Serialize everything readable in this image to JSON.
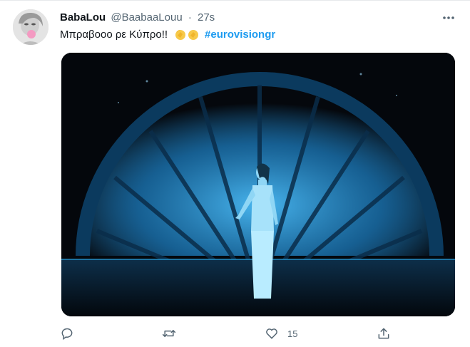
{
  "tweet": {
    "display_name": "BabaLou",
    "handle": "@BaabaaLouu",
    "separator": "·",
    "time": "27s",
    "text": "Μπραβοοο ρε Κύπρο!!",
    "emoji_icon": "clapping-hands-icon",
    "hashtag": "#eurovisiongr",
    "avatar_icon": "avatar",
    "media_description_icon": "stage-performance-image",
    "actions": {
      "reply_icon": "reply-icon",
      "retweet_icon": "retweet-icon",
      "like_icon": "heart-icon",
      "like_count": "15",
      "share_icon": "share-icon"
    },
    "more_icon": "more-dots-icon"
  },
  "colors": {
    "accent": "#1d9bf0",
    "text": "#0f1419",
    "secondary": "#536471",
    "stage_blue": "#1e8fc9"
  }
}
